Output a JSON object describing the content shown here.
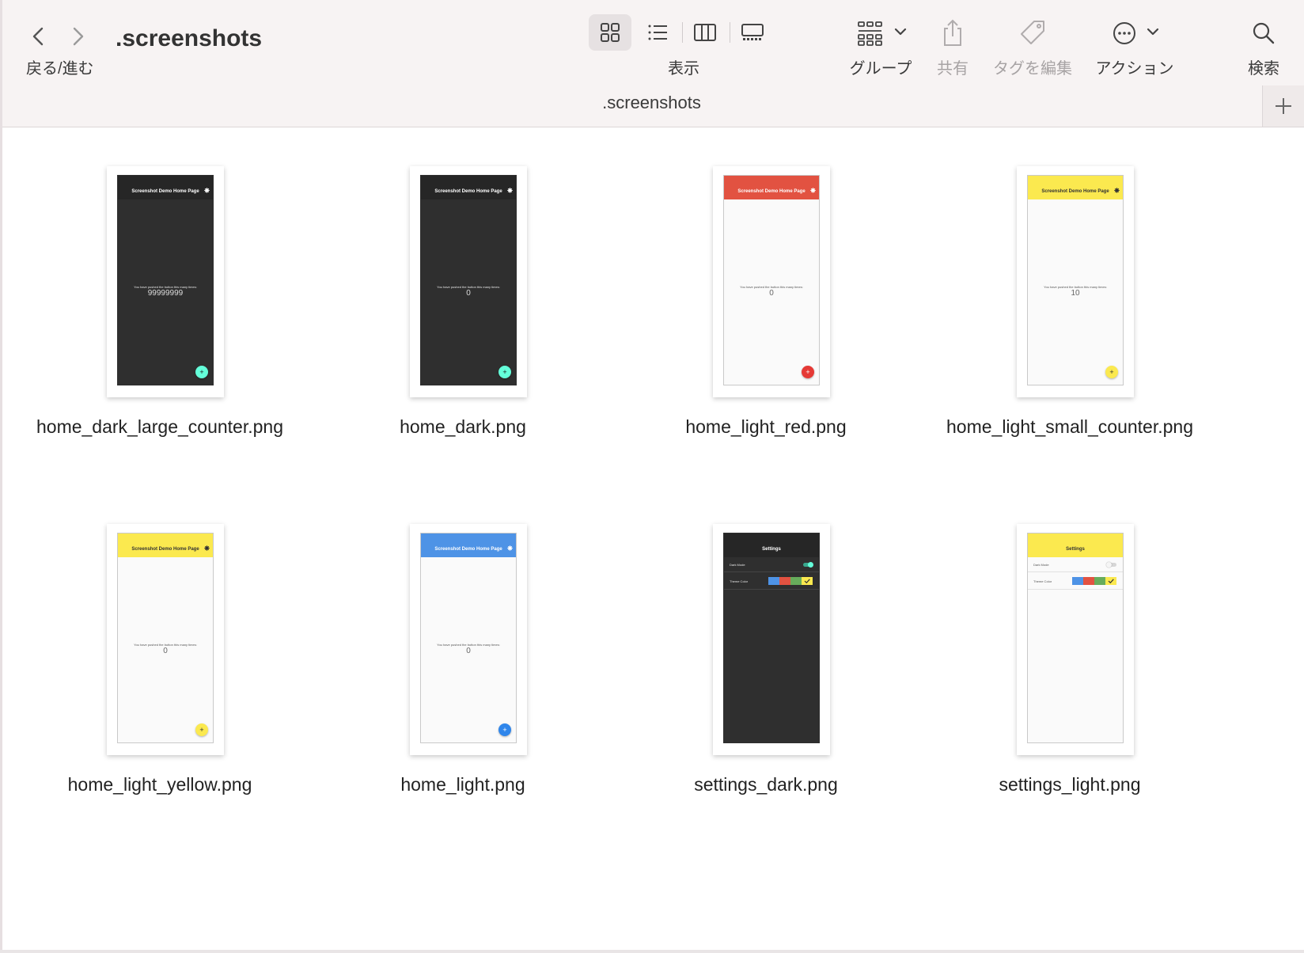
{
  "window": {
    "folder_title": ".screenshots",
    "path_title": ".screenshots"
  },
  "toolbar": {
    "nav_label": "戻る/進む",
    "view_label": "表示",
    "group_label": "グループ",
    "share_label": "共有",
    "tags_label": "タグを編集",
    "action_label": "アクション",
    "search_label": "検索",
    "view_modes": [
      "icon-view-icon",
      "list-view-icon",
      "column-view-icon",
      "gallery-view-icon"
    ],
    "active_view": "icon-view-icon"
  },
  "files": [
    {
      "name": "home_dark_large_counter.png",
      "kind": "home",
      "theme": "dark",
      "appbar_color": "#262626",
      "appbar_text_color": "#ffffff",
      "title": "Screenshot Demo Home Page",
      "body_text": "You have pushed the button this many times:",
      "counter": "99999999",
      "fab_color": "#64ffda",
      "fab_icon_color": "#1a1a1a"
    },
    {
      "name": "home_dark.png",
      "kind": "home",
      "theme": "dark",
      "appbar_color": "#262626",
      "appbar_text_color": "#ffffff",
      "title": "Screenshot Demo Home Page",
      "body_text": "You have pushed the button this many times:",
      "counter": "0",
      "fab_color": "#64ffda",
      "fab_icon_color": "#1a1a1a"
    },
    {
      "name": "home_light_red.png",
      "kind": "home",
      "theme": "light",
      "appbar_color": "#e25241",
      "appbar_text_color": "#ffffff",
      "title": "Screenshot Demo Home Page",
      "body_text": "You have pushed the button this many times:",
      "counter": "0",
      "fab_color": "#e53935",
      "fab_icon_color": "#ffffff"
    },
    {
      "name": "home_light_small_counter.png",
      "kind": "home",
      "theme": "light",
      "appbar_color": "#fbe94f",
      "appbar_text_color": "#333333",
      "title": "Screenshot Demo Home Page",
      "body_text": "You have pushed the button this many times:",
      "counter": "10",
      "fab_color": "#fbe94f",
      "fab_icon_color": "#333333"
    },
    {
      "name": "home_light_yellow.png",
      "kind": "home",
      "theme": "light",
      "appbar_color": "#fbe94f",
      "appbar_text_color": "#333333",
      "title": "Screenshot Demo Home Page",
      "body_text": "You have pushed the button this many times:",
      "counter": "0",
      "fab_color": "#fbe94f",
      "fab_icon_color": "#333333"
    },
    {
      "name": "home_light.png",
      "kind": "home",
      "theme": "light",
      "appbar_color": "#4e93e6",
      "appbar_text_color": "#ffffff",
      "title": "Screenshot Demo Home Page",
      "body_text": "You have pushed the button this many times:",
      "counter": "0",
      "fab_color": "#2f86eb",
      "fab_icon_color": "#ffffff"
    },
    {
      "name": "settings_dark.png",
      "kind": "settings",
      "theme": "dark",
      "appbar_color": "#262626",
      "appbar_text_color": "#ffffff",
      "title": "Settings",
      "dark_mode_label": "Dark Mode",
      "theme_color_label": "Theme Color",
      "dark_mode_on": true,
      "toggle_color": "#64ffda",
      "swatch_colors": [
        "#4e93e6",
        "#e25241",
        "#67ac5b",
        "#fbe94f"
      ],
      "selected_swatch": 3
    },
    {
      "name": "settings_light.png",
      "kind": "settings",
      "theme": "light",
      "appbar_color": "#fbe94f",
      "appbar_text_color": "#333333",
      "title": "Settings",
      "dark_mode_label": "Dark Mode",
      "theme_color_label": "Theme Color",
      "dark_mode_on": false,
      "toggle_color": "#cfcfcf",
      "swatch_colors": [
        "#4e93e6",
        "#e25241",
        "#67ac5b",
        "#fbe94f"
      ],
      "selected_swatch": 3
    }
  ]
}
